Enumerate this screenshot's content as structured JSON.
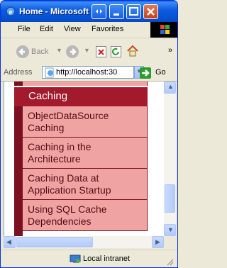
{
  "window": {
    "title": "Home - Microsoft"
  },
  "menubar": {
    "items": [
      {
        "label": "File",
        "accel": "F"
      },
      {
        "label": "Edit",
        "accel": "E"
      },
      {
        "label": "View",
        "accel": "V"
      },
      {
        "label": "Favorites",
        "accel": "a"
      }
    ]
  },
  "toolbar": {
    "back_label": "Back"
  },
  "address": {
    "label": "Address",
    "accel": "d",
    "url": "http://localhost:30",
    "go_label": "Go"
  },
  "page": {
    "section_title": "Caching",
    "items": [
      "ObjectDataSource Caching",
      "Caching in the Architecture",
      "Caching Data at Application Startup",
      "Using SQL Cache Dependencies"
    ]
  },
  "status": {
    "zone": "Local intranet"
  },
  "colors": {
    "titlebar": "#0550d0",
    "menu_header": "#a21a2c",
    "menu_item_bg": "#f0a3a3",
    "menu_border": "#7a1020"
  }
}
